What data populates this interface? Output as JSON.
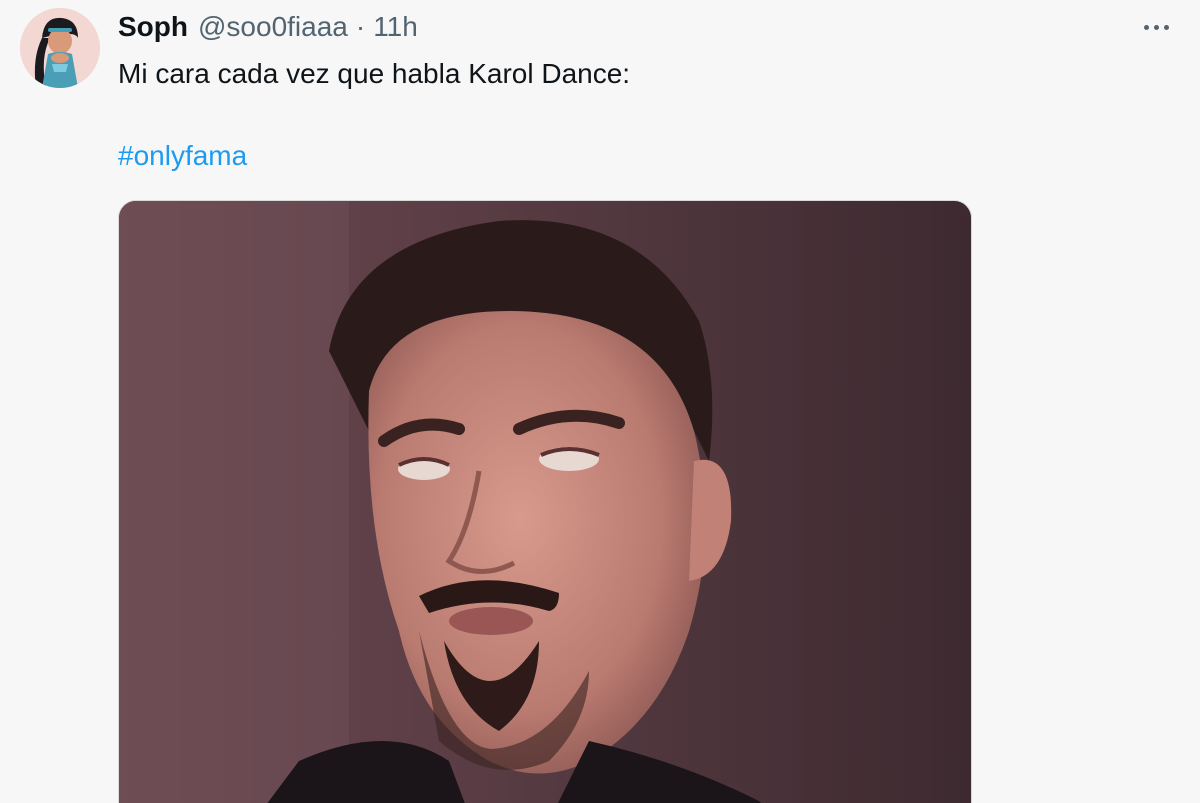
{
  "post": {
    "author_name": "Soph",
    "author_handle": "@soo0fiaaa",
    "separator": "·",
    "timestamp": "11h",
    "text": "Mi cara cada vez que habla Karol Dance:",
    "hashtag": "#onlyfama"
  },
  "icons": {
    "avatar": "avatar-image",
    "more": "more-options-icon"
  },
  "colors": {
    "text_primary": "#0f1419",
    "text_secondary": "#536471",
    "link": "#1d9bf0",
    "background": "#f7f7f7"
  }
}
